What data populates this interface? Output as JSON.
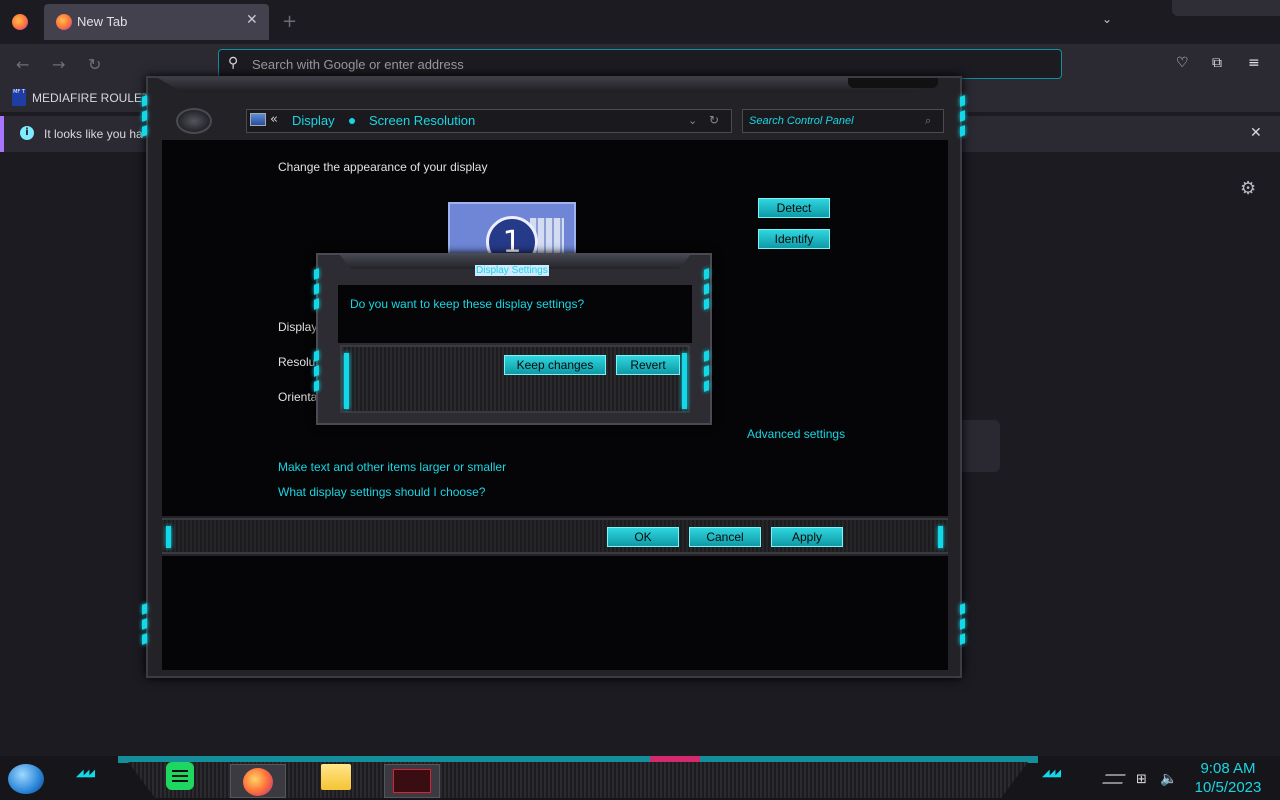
{
  "browser": {
    "tab_title": "New Tab",
    "tab_close": "✕",
    "new_tab": "+",
    "tab_list": "⌄",
    "back": "←",
    "forward": "→",
    "reload": "↻",
    "search_placeholder": "Search with Google or enter address",
    "bookmark_icon_text": "MF T",
    "bookmark_label": "MEDIAFIRE ROULET",
    "notice_text": "It looks like you ha",
    "notice_close": "✕",
    "notice_icon": "i",
    "pocket": "♡",
    "extensions": "⧉",
    "menu": "≡",
    "settings": "⚙",
    "accent_color": "#0e8f9e"
  },
  "control_panel": {
    "breadcrumb_arrows": "«",
    "breadcrumb_display": "Display",
    "breadcrumb_resolution": "Screen Resolution",
    "dropdown_icon": "⌄",
    "refresh_icon": "↻",
    "search_placeholder": "Search Control Panel",
    "search_icon": "⌕",
    "heading": "Change the appearance of your display",
    "monitor_number": "1",
    "detect": "Detect",
    "identify": "Identify",
    "display_label": "Display:",
    "resolution_label": "Resoluti",
    "orientation_label": "Orientat",
    "advanced_settings": "Advanced settings",
    "link_text_size": "Make text and other items larger or smaller",
    "link_help": "What display settings should I choose?",
    "ok": "OK",
    "cancel": "Cancel",
    "apply": "Apply",
    "accent_color": "#19d6e3"
  },
  "dialog": {
    "title": "Display Settings",
    "question": "Do you want to keep these display settings?",
    "keep_changes": "Keep changes",
    "revert": "Revert"
  },
  "taskbar": {
    "time": "9:08 AM",
    "date": "10/5/2023",
    "network_icon": "⊞",
    "volume_icon": "🔈",
    "deco": "◢◢◢"
  }
}
